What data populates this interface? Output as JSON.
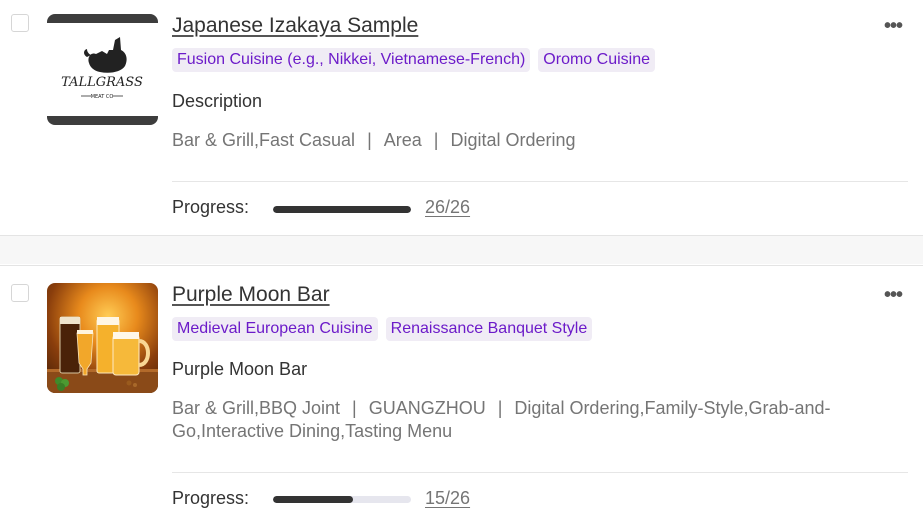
{
  "cards": [
    {
      "title": "Japanese Izakaya Sample",
      "tags": [
        "Fusion Cuisine (e.g., Nikkei, Vietnamese-French)",
        "Oromo Cuisine"
      ],
      "description": "Description",
      "meta": [
        "Bar & Grill,Fast Casual",
        "Area",
        "Digital Ordering"
      ],
      "progress_label": "Progress:",
      "progress_count": "26/26",
      "progress_fraction": 1.0,
      "thumbnail_logo": {
        "line1": "TALLGRASS",
        "line2": "MEAT CO"
      },
      "more_icon": "more-horizontal-icon"
    },
    {
      "title": "Purple Moon Bar",
      "tags": [
        "Medieval European Cuisine",
        "Renaissance Banquet Style"
      ],
      "description": "Purple Moon Bar",
      "meta": [
        "Bar & Grill,BBQ Joint",
        "GUANGZHOU",
        "Digital Ordering,Family-Style,Grab-and-Go,Interactive Dining,Tasting Menu"
      ],
      "progress_label": "Progress:",
      "progress_count": "15/26",
      "progress_fraction": 0.577,
      "more_icon": "more-horizontal-icon"
    }
  ],
  "meta_separator": "|",
  "more_glyph": "•••",
  "colors": {
    "tag_text": "#6c1bc9",
    "tag_bg": "#f0ecf5",
    "progress_fill": "#333333",
    "progress_track": "#e6e6ee"
  }
}
